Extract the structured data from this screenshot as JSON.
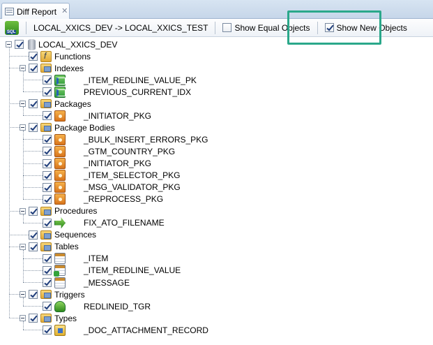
{
  "tab": {
    "icon": "report-icon",
    "label": "Diff Report",
    "close": "✕"
  },
  "toolbar": {
    "sql_button_icon": "generate-sql-icon",
    "connection_text": "LOCAL_XXICS_DEV -> LOCAL_XXICS_TEST",
    "show_equal_label": "Show Equal Objects",
    "show_equal_checked": false,
    "show_new_label": "Show New Objects",
    "show_new_checked": true,
    "highlight_color": "#2aa88a"
  },
  "tree": {
    "root": {
      "label": "LOCAL_XXICS_DEV",
      "icon": "database-icon",
      "checked": true
    },
    "rows": [
      {
        "depth": 1,
        "label": "Functions",
        "icon": "functions-folder-icon",
        "expander": false,
        "checked": true
      },
      {
        "depth": 1,
        "label": "Indexes",
        "icon": "indexes-folder-icon",
        "expander": true,
        "checked": true
      },
      {
        "depth": 2,
        "label": "_ITEM_REDLINE_VALUE_PK",
        "icon": "index-icon",
        "checked": true
      },
      {
        "depth": 2,
        "label": "PREVIOUS_CURRENT_IDX",
        "icon": "index-icon",
        "checked": true
      },
      {
        "depth": 1,
        "label": "Packages",
        "icon": "packages-folder-icon",
        "expander": true,
        "checked": true
      },
      {
        "depth": 2,
        "label": "_INITIATOR_PKG",
        "icon": "package-icon",
        "checked": true
      },
      {
        "depth": 1,
        "label": "Package Bodies",
        "icon": "package-bodies-folder-icon",
        "expander": true,
        "checked": true
      },
      {
        "depth": 2,
        "label": "_BULK_INSERT_ERRORS_PKG",
        "icon": "package-body-icon",
        "checked": true
      },
      {
        "depth": 2,
        "label": "_GTM_COUNTRY_PKG",
        "icon": "package-body-icon",
        "checked": true
      },
      {
        "depth": 2,
        "label": "_INITIATOR_PKG",
        "icon": "package-body-icon",
        "checked": true
      },
      {
        "depth": 2,
        "label": "_ITEM_SELECTOR_PKG",
        "icon": "package-body-icon",
        "checked": true
      },
      {
        "depth": 2,
        "label": "_MSG_VALIDATOR_PKG",
        "icon": "package-body-icon",
        "checked": true
      },
      {
        "depth": 2,
        "label": "_REPROCESS_PKG",
        "icon": "package-body-icon",
        "checked": true
      },
      {
        "depth": 1,
        "label": "Procedures",
        "icon": "procedures-folder-icon",
        "expander": true,
        "checked": true
      },
      {
        "depth": 2,
        "label": "FIX_ATO_FILENAME",
        "icon": "procedure-icon",
        "checked": true
      },
      {
        "depth": 1,
        "label": "Sequences",
        "icon": "sequences-folder-icon",
        "expander": false,
        "checked": true
      },
      {
        "depth": 1,
        "label": "Tables",
        "icon": "tables-folder-icon",
        "expander": true,
        "checked": true
      },
      {
        "depth": 2,
        "label": "_ITEM",
        "icon": "table-icon",
        "checked": true
      },
      {
        "depth": 2,
        "label": "_ITEM_REDLINE_VALUE",
        "icon": "table-new-icon",
        "checked": true
      },
      {
        "depth": 2,
        "label": "_MESSAGE",
        "icon": "table-icon",
        "checked": true
      },
      {
        "depth": 1,
        "label": "Triggers",
        "icon": "triggers-folder-icon",
        "expander": true,
        "checked": true
      },
      {
        "depth": 2,
        "label": "REDLINEID_TGR",
        "icon": "trigger-icon",
        "checked": true
      },
      {
        "depth": 1,
        "label": "Types",
        "icon": "types-folder-icon",
        "expander": true,
        "checked": true
      },
      {
        "depth": 2,
        "label": "_DOC_ATTACHMENT_RECORD",
        "icon": "type-icon",
        "checked": true
      }
    ]
  }
}
